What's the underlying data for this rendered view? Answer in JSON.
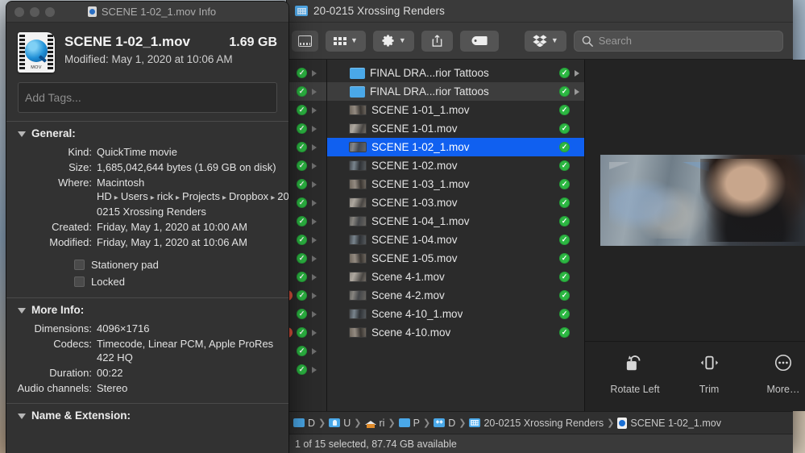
{
  "finder": {
    "title": "20-0215 Xrossing Renders",
    "toolbar": {
      "view_icon": "grid-view-icon",
      "arrange_icon": "arrange-icon",
      "action_icon": "gear-icon",
      "share_icon": "share-icon",
      "tag_icon": "tag-icon",
      "dropbox_icon": "dropbox-icon",
      "search_icon": "search-icon",
      "search_placeholder": "Search"
    },
    "files": [
      {
        "name": "FINAL DRA...rior Tattoos",
        "type": "folder",
        "synced": true,
        "has_arrow": true,
        "selected": false,
        "highlight": false
      },
      {
        "name": "FINAL DRA...rior Tattoos",
        "type": "folder",
        "synced": true,
        "has_arrow": true,
        "selected": false,
        "highlight": true
      },
      {
        "name": "SCENE 1-01_1.mov",
        "type": "movie",
        "synced": true,
        "has_arrow": false,
        "selected": false,
        "highlight": false
      },
      {
        "name": "SCENE 1-01.mov",
        "type": "movie",
        "synced": true,
        "has_arrow": false,
        "selected": false,
        "highlight": false
      },
      {
        "name": "SCENE 1-02_1.mov",
        "type": "movie",
        "synced": true,
        "has_arrow": false,
        "selected": true,
        "highlight": false
      },
      {
        "name": "SCENE 1-02.mov",
        "type": "movie",
        "synced": true,
        "has_arrow": false,
        "selected": false,
        "highlight": false
      },
      {
        "name": "SCENE 1-03_1.mov",
        "type": "movie",
        "synced": true,
        "has_arrow": false,
        "selected": false,
        "highlight": false
      },
      {
        "name": "SCENE 1-03.mov",
        "type": "movie",
        "synced": true,
        "has_arrow": false,
        "selected": false,
        "highlight": false
      },
      {
        "name": "SCENE 1-04_1.mov",
        "type": "movie",
        "synced": true,
        "has_arrow": false,
        "selected": false,
        "highlight": false
      },
      {
        "name": "SCENE 1-04.mov",
        "type": "movie",
        "synced": true,
        "has_arrow": false,
        "selected": false,
        "highlight": false
      },
      {
        "name": "SCENE 1-05.mov",
        "type": "movie",
        "synced": true,
        "has_arrow": false,
        "selected": false,
        "highlight": false
      },
      {
        "name": "Scene 4-1.mov",
        "type": "movie",
        "synced": true,
        "has_arrow": false,
        "selected": false,
        "highlight": false
      },
      {
        "name": "Scene 4-2.mov",
        "type": "movie",
        "synced": true,
        "has_arrow": false,
        "selected": false,
        "highlight": false
      },
      {
        "name": "Scene 4-10_1.mov",
        "type": "movie",
        "synced": true,
        "has_arrow": false,
        "selected": false,
        "highlight": false
      },
      {
        "name": "Scene 4-10.mov",
        "type": "movie",
        "synced": true,
        "has_arrow": false,
        "selected": false,
        "highlight": false
      }
    ],
    "prev_column_rows": [
      {
        "synced": true,
        "has_arrow": true,
        "red": false,
        "highlight": false
      },
      {
        "synced": true,
        "has_arrow": true,
        "red": false,
        "highlight": true
      },
      {
        "synced": true,
        "has_arrow": true,
        "red": false,
        "highlight": false
      },
      {
        "synced": true,
        "has_arrow": true,
        "red": false,
        "highlight": false
      },
      {
        "synced": true,
        "has_arrow": true,
        "red": false,
        "highlight": false
      },
      {
        "synced": true,
        "has_arrow": true,
        "red": false,
        "highlight": false
      },
      {
        "synced": true,
        "has_arrow": true,
        "red": false,
        "highlight": false
      },
      {
        "synced": true,
        "has_arrow": true,
        "red": false,
        "highlight": false
      },
      {
        "synced": true,
        "has_arrow": true,
        "red": false,
        "highlight": false
      },
      {
        "synced": true,
        "has_arrow": true,
        "red": false,
        "highlight": false
      },
      {
        "synced": true,
        "has_arrow": true,
        "red": false,
        "highlight": false
      },
      {
        "synced": true,
        "has_arrow": true,
        "red": false,
        "highlight": false
      },
      {
        "synced": true,
        "has_arrow": true,
        "red": true,
        "highlight": false
      },
      {
        "synced": true,
        "has_arrow": true,
        "red": false,
        "highlight": false
      },
      {
        "synced": true,
        "has_arrow": true,
        "red": true,
        "highlight": false
      },
      {
        "synced": true,
        "has_arrow": true,
        "red": false,
        "highlight": false
      },
      {
        "synced": true,
        "has_arrow": true,
        "red": false,
        "highlight": false
      }
    ],
    "preview": {
      "actions": [
        {
          "label": "Rotate Left",
          "icon": "rotate-left-icon"
        },
        {
          "label": "Trim",
          "icon": "trim-icon"
        },
        {
          "label": "More…",
          "icon": "more-ellipsis-icon"
        }
      ]
    },
    "pathbar": [
      {
        "label": "D",
        "icon": "disk-icon"
      },
      {
        "label": "U",
        "icon": "users-folder-icon"
      },
      {
        "label": "ri",
        "icon": "home-icon"
      },
      {
        "label": "P",
        "icon": "folder-icon"
      },
      {
        "label": "D",
        "icon": "dropbox-folder-icon"
      },
      {
        "label": "20-0215 Xrossing Renders",
        "icon": "renders-folder-icon"
      },
      {
        "label": "SCENE 1-02_1.mov",
        "icon": "movie-doc-icon"
      }
    ],
    "status": "1 of 15 selected, 87.74 GB available"
  },
  "info_window": {
    "title": "SCENE 1-02_1.mov Info",
    "title_icon": "movie-doc-icon",
    "traffic_lights": [
      "close-button",
      "minimize-button",
      "zoom-button"
    ],
    "file_icon": "quicktime-mov-icon",
    "file_name": "SCENE 1-02_1.mov",
    "file_size": "1.69 GB",
    "modified_line": "Modified: May 1, 2020 at 10:06 AM",
    "tags_placeholder": "Add Tags...",
    "general": {
      "heading": "General:",
      "rows": [
        {
          "key": "Kind:",
          "value": "QuickTime movie"
        },
        {
          "key": "Size:",
          "value": "1,685,042,644 bytes (1.69 GB on disk)"
        },
        {
          "key": "Created:",
          "value": "Friday, May 1, 2020 at 10:00 AM"
        },
        {
          "key": "Modified:",
          "value": "Friday, May 1, 2020 at 10:06 AM"
        }
      ],
      "where_key": "Where:",
      "where_parts": [
        "Macintosh HD",
        "Users",
        "rick",
        "Projects",
        "Dropbox",
        "20-0215 Xrossing Renders"
      ],
      "checkboxes": [
        {
          "label": "Stationery pad",
          "checked": false
        },
        {
          "label": "Locked",
          "checked": false
        }
      ]
    },
    "more_info": {
      "heading": "More Info:",
      "rows": [
        {
          "key": "Dimensions:",
          "value": "4096×1716"
        },
        {
          "key": "Codecs:",
          "value": "Timecode, Linear PCM, Apple ProRes 422 HQ"
        },
        {
          "key": "Duration:",
          "value": "00:22"
        },
        {
          "key": "Audio channels:",
          "value": "Stereo"
        }
      ]
    },
    "name_extension": {
      "heading": "Name & Extension:"
    }
  },
  "colors": {
    "selection_blue": "#1060f0",
    "sync_green": "#2cb742",
    "folder_blue": "#4aa8e8",
    "red_badge": "#e8553f"
  }
}
